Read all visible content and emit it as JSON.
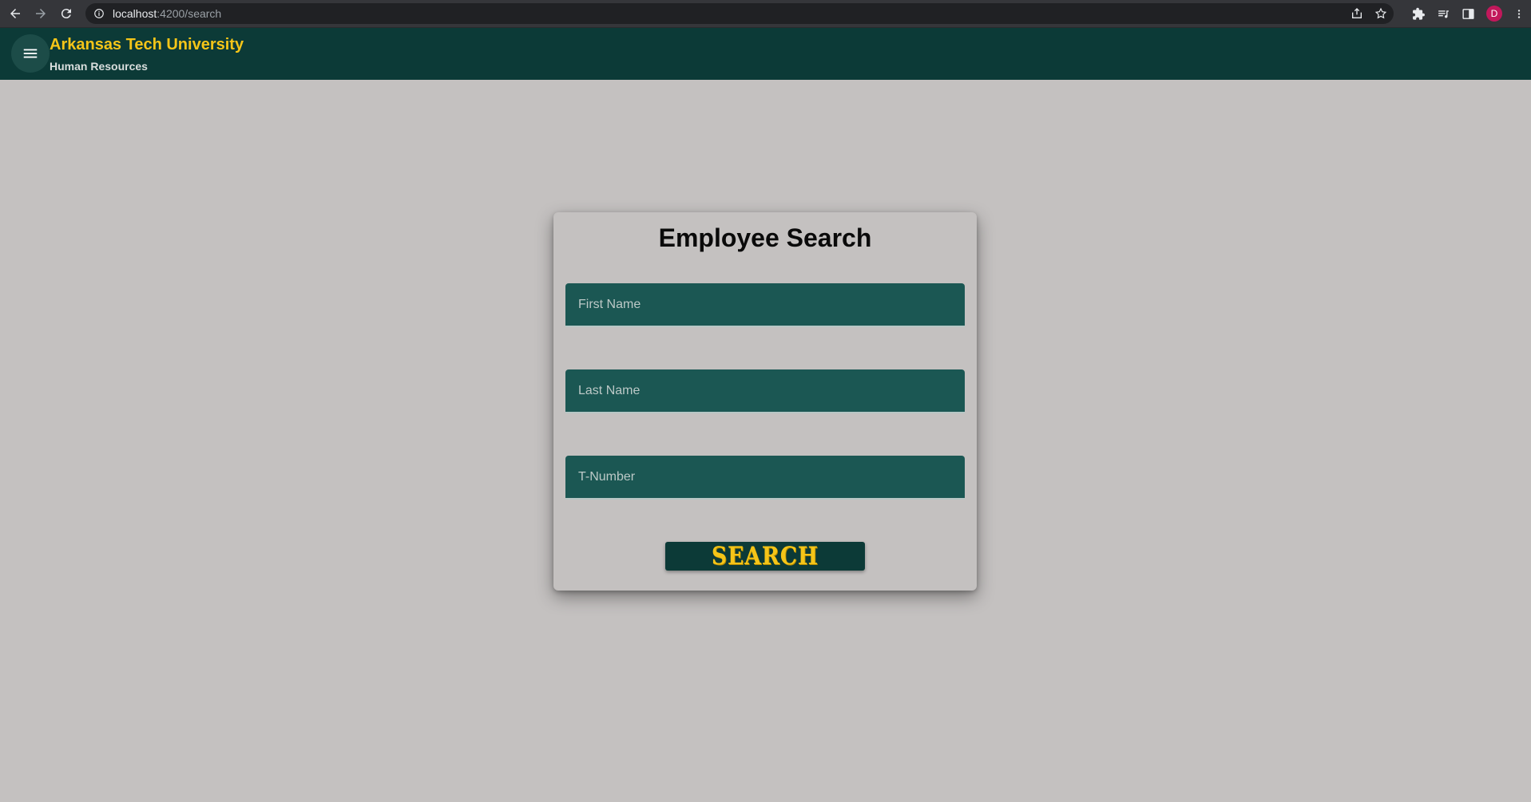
{
  "browser": {
    "url_host": "localhost",
    "url_path": ":4200/search",
    "profile_initial": "D"
  },
  "toolbar": {
    "title": "Arkansas Tech University",
    "subtitle": "Human Resources",
    "menu_icon": "menu-icon",
    "colors": {
      "background": "#0c3a37",
      "title": "#f5c518"
    }
  },
  "search_form": {
    "title": "Employee Search",
    "first_name_placeholder": "First Name",
    "last_name_placeholder": "Last Name",
    "t_number_placeholder": "T-Number",
    "submit_label": "SEARCH",
    "colors": {
      "field_background": "#1b5753",
      "button_background": "#0c3a37",
      "button_text": "#f5c518"
    }
  }
}
